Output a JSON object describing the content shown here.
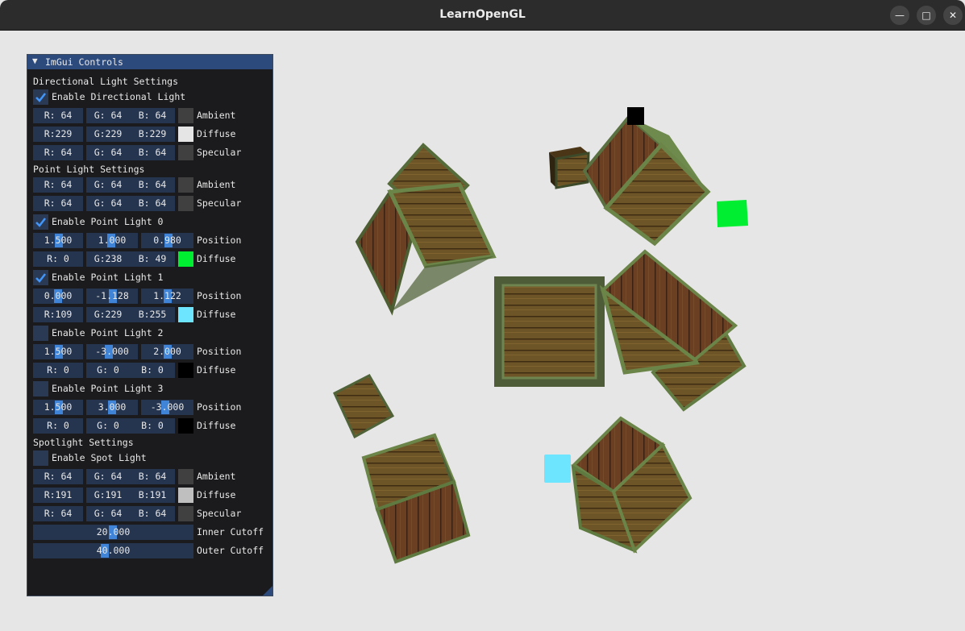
{
  "window": {
    "title": "LearnOpenGL"
  },
  "panel": {
    "title": "ImGui Controls",
    "directional": {
      "heading": "Directional Light Settings",
      "enable_label": "Enable Directional Light",
      "enabled": true,
      "ambient": {
        "r": "R: 64",
        "g": "G: 64",
        "b": "B: 64",
        "label": "Ambient",
        "color": "#404040"
      },
      "diffuse": {
        "r": "R:229",
        "g": "G:229",
        "b": "B:229",
        "label": "Diffuse",
        "color": "#e5e5e5"
      },
      "specular": {
        "r": "R: 64",
        "g": "G: 64",
        "b": "B: 64",
        "label": "Specular",
        "color": "#404040"
      }
    },
    "point": {
      "heading": "Point Light Settings",
      "ambient": {
        "r": "R: 64",
        "g": "G: 64",
        "b": "B: 64",
        "label": "Ambient",
        "color": "#404040"
      },
      "specular": {
        "r": "R: 64",
        "g": "G: 64",
        "b": "B: 64",
        "label": "Specular",
        "color": "#404040"
      },
      "lights": [
        {
          "enable_label": "Enable Point Light 0",
          "enabled": true,
          "position": [
            "1.500",
            "1.000",
            "0.980"
          ],
          "position_label": "Position",
          "diffuse": {
            "r": "R: 0",
            "g": "G:238",
            "b": "B: 49",
            "label": "Diffuse",
            "color": "#00ee31"
          }
        },
        {
          "enable_label": "Enable Point Light 1",
          "enabled": true,
          "position": [
            "0.000",
            "-1.128",
            "1.122"
          ],
          "position_label": "Position",
          "diffuse": {
            "r": "R:109",
            "g": "G:229",
            "b": "B:255",
            "label": "Diffuse",
            "color": "#6de5ff"
          }
        },
        {
          "enable_label": "Enable Point Light 2",
          "enabled": false,
          "position": [
            "1.500",
            "-3.000",
            "2.000"
          ],
          "position_label": "Position",
          "diffuse": {
            "r": "R: 0",
            "g": "G: 0",
            "b": "B: 0",
            "label": "Diffuse",
            "color": "#000000"
          }
        },
        {
          "enable_label": "Enable Point Light 3",
          "enabled": false,
          "position": [
            "1.500",
            "3.000",
            "-3.000"
          ],
          "position_label": "Position",
          "diffuse": {
            "r": "R: 0",
            "g": "G: 0",
            "b": "B: 0",
            "label": "Diffuse",
            "color": "#000000"
          }
        }
      ]
    },
    "spot": {
      "heading": "Spotlight Settings",
      "enable_label": "Enable Spot Light",
      "enabled": false,
      "ambient": {
        "r": "R: 64",
        "g": "G: 64",
        "b": "B: 64",
        "label": "Ambient",
        "color": "#404040"
      },
      "diffuse": {
        "r": "R:191",
        "g": "G:191",
        "b": "B:191",
        "label": "Diffuse",
        "color": "#bfbfbf"
      },
      "specular": {
        "r": "R: 64",
        "g": "G: 64",
        "b": "B: 64",
        "label": "Specular",
        "color": "#404040"
      },
      "inner": {
        "value": "20.000",
        "label": "Inner Cutoff"
      },
      "outer": {
        "value": "40.000",
        "label": "Outer Cutoff"
      }
    }
  },
  "scene": {
    "background": "#e6e6e6",
    "light_cubes": [
      "#00ee31",
      "#6de5ff",
      "#000000"
    ]
  }
}
